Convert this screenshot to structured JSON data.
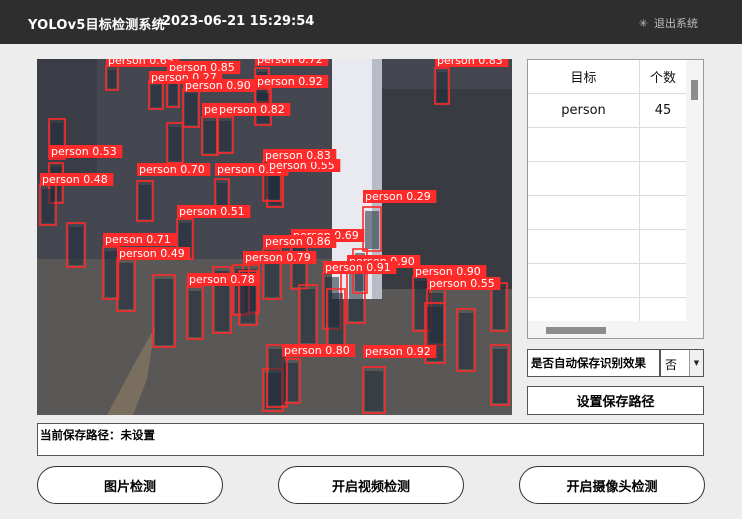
{
  "header": {
    "app_title": "YOLOv5目标检测系统",
    "datetime": "2023-06-21 15:29:54",
    "exit_label": "退出系统",
    "exit_icon": "sparkle-icon"
  },
  "video": {
    "detection_labels": [
      "person 0.65",
      "person 0.85",
      "person 0.72",
      "person 0.83",
      "person 0.27",
      "person 0.90",
      "person 0.92",
      "person 0.85",
      "person 0.82",
      "person 0.53",
      "person 0.48",
      "person 0.70",
      "person 0.58",
      "person 0.55",
      "person 0.83",
      "person 0.29",
      "person 0.51",
      "person 0.69",
      "person 0.71",
      "person 0.86",
      "person 0.49",
      "person 0.79",
      "person 0.90",
      "person 0.91",
      "person 0.90",
      "person 0.55",
      "person 0.78",
      "person 0.80",
      "person 0.92"
    ],
    "box_color": "#ff2a2a"
  },
  "result_table": {
    "headers": [
      "目标",
      "个数"
    ],
    "rows": [
      [
        "person",
        "45"
      ]
    ]
  },
  "auto_save": {
    "label": "是否自动保存识别效果",
    "selected": "否"
  },
  "buttons": {
    "set_path": "设置保存路径",
    "image_detect": "图片检测",
    "video_detect": "开启视频检测",
    "camera_detect": "开启摄像头检测"
  },
  "save_path": {
    "text": "当前保存路径：未设置"
  }
}
